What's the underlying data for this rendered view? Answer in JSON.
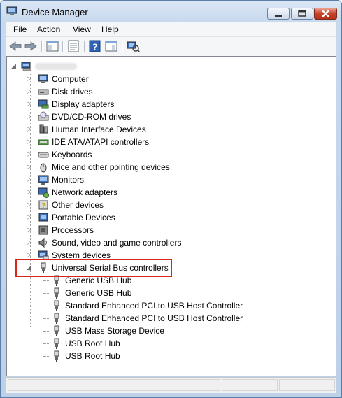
{
  "window": {
    "title": "Device Manager",
    "colors": {
      "close": "#c7432a",
      "highlight_box": "#d9261c",
      "frame": "#5a7ea8"
    }
  },
  "menu": [
    "File",
    "Action",
    "View",
    "Help"
  ],
  "toolbar": {
    "buttons": [
      "back-icon",
      "forward-icon",
      "show-hide-console-tree-icon",
      "properties-icon",
      "help-icon",
      "action-pane-icon",
      "scan-hardware-icon"
    ]
  },
  "tree": {
    "categories": [
      {
        "label": "Computer",
        "icon": "computer-icon"
      },
      {
        "label": "Disk drives",
        "icon": "disk-drive-icon"
      },
      {
        "label": "Display adapters",
        "icon": "display-adapter-icon"
      },
      {
        "label": "DVD/CD-ROM drives",
        "icon": "dvd-drive-icon"
      },
      {
        "label": "Human Interface Devices",
        "icon": "hid-icon"
      },
      {
        "label": "IDE ATA/ATAPI controllers",
        "icon": "ide-controller-icon"
      },
      {
        "label": "Keyboards",
        "icon": "keyboard-icon"
      },
      {
        "label": "Mice and other pointing devices",
        "icon": "mouse-icon"
      },
      {
        "label": "Monitors",
        "icon": "monitor-icon"
      },
      {
        "label": "Network adapters",
        "icon": "network-adapter-icon"
      },
      {
        "label": "Other devices",
        "icon": "other-devices-icon"
      },
      {
        "label": "Portable Devices",
        "icon": "portable-device-icon"
      },
      {
        "label": "Processors",
        "icon": "processor-icon"
      },
      {
        "label": "Sound, video and game controllers",
        "icon": "sound-icon"
      },
      {
        "label": "System devices",
        "icon": "system-devices-icon"
      }
    ],
    "usb": {
      "label": "Universal Serial Bus controllers",
      "children": [
        "Generic USB Hub",
        "Generic USB Hub",
        "Standard Enhanced PCI to USB Host Controller",
        "Standard Enhanced PCI to USB Host Controller",
        "USB Mass Storage Device",
        "USB Root Hub",
        "USB Root Hub"
      ]
    }
  }
}
